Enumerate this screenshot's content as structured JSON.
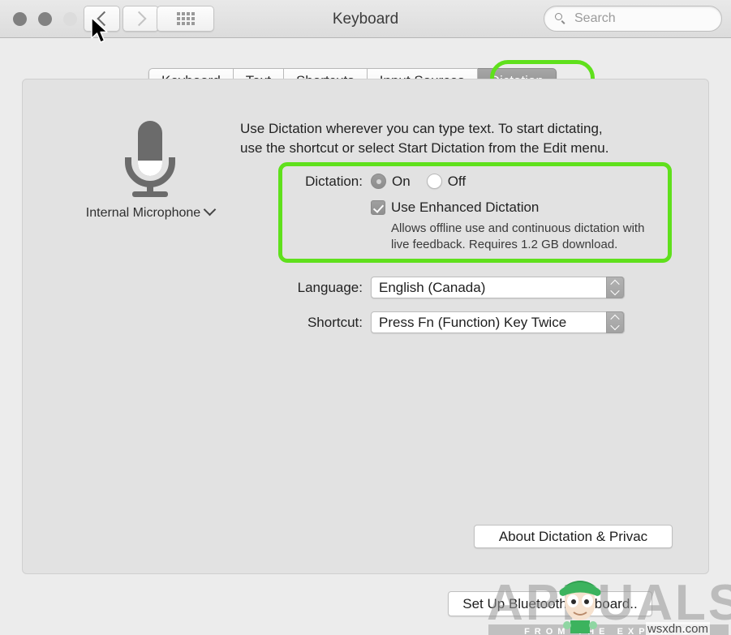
{
  "window": {
    "title": "Keyboard",
    "traffic_lights": [
      "close",
      "minimize",
      "zoom"
    ]
  },
  "toolbar": {
    "back_label": "Back",
    "forward_label": "Forward",
    "showall_label": "Show All",
    "search": {
      "placeholder": "Search",
      "value": "",
      "icon": "search-icon"
    }
  },
  "tabs": [
    {
      "label": "Keyboard",
      "selected": false
    },
    {
      "label": "Text",
      "selected": false
    },
    {
      "label": "Shortcuts",
      "selected": false
    },
    {
      "label": "Input Sources",
      "selected": false
    },
    {
      "label": "Dictation",
      "selected": true
    }
  ],
  "annotations": {
    "color": "#5FE01C",
    "highlights": [
      "dictation-tab",
      "dictation-settings-group"
    ]
  },
  "main": {
    "microphone": {
      "icon": "microphone-icon",
      "label": "Internal Microphone",
      "chevron": "chevron-down-icon"
    },
    "description_line1": "Use Dictation wherever you can type text. To start dictating,",
    "description_line2": "use the shortcut or select Start Dictation from the Edit menu.",
    "dictation": {
      "label": "Dictation:",
      "on_label": "On",
      "off_label": "Off",
      "selected": "On",
      "enhanced": {
        "label": "Use Enhanced Dictation",
        "checked": true,
        "help_line1": "Allows offline use and continuous dictation with",
        "help_line2": "live feedback. Requires 1.2 GB download."
      }
    },
    "language": {
      "label": "Language:",
      "value": "English (Canada)"
    },
    "shortcut": {
      "label": "Shortcut:",
      "value": "Press Fn (Function) Key Twice"
    },
    "about_button": "About Dictation & Privac"
  },
  "footer": {
    "bluetooth_button": "Set Up Bluetooth Keyboard.."
  },
  "watermark": {
    "word": "APPUALS",
    "tagline": "FROM THE EXPERTS",
    "domain": "wsxdn.com"
  }
}
